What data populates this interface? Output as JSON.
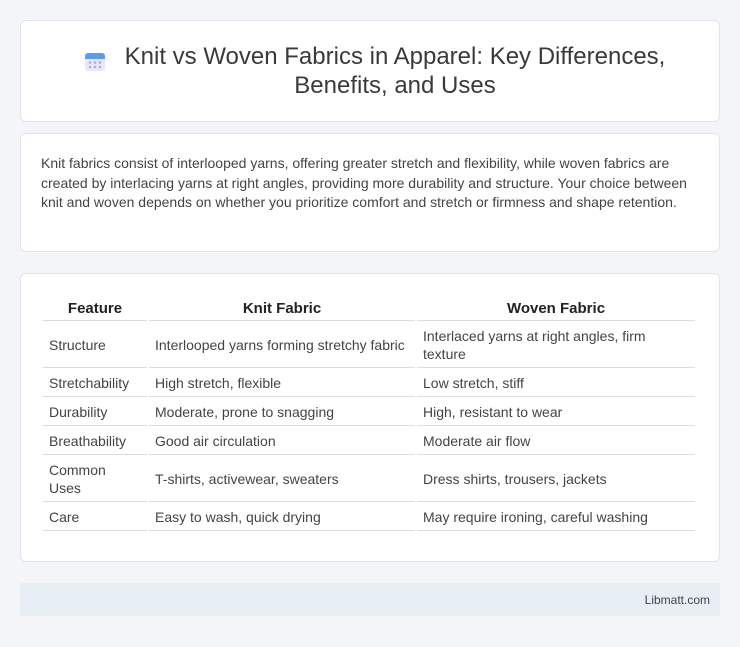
{
  "header": {
    "title": "Knit vs Woven Fabrics in Apparel: Key Differences, Benefits, and Uses",
    "icon": "calendar-icon",
    "icon_colors": {
      "top": "#5b9bf0",
      "body": "#e9e3f7",
      "dots": "#b9a3e8"
    }
  },
  "intro": {
    "text": "Knit fabrics consist of interlooped yarns, offering greater stretch and flexibility, while woven fabrics are created by interlacing yarns at right angles, providing more durability and structure. Your choice between knit and woven depends on whether you prioritize comfort and stretch or firmness and shape retention."
  },
  "table": {
    "headers": [
      "Feature",
      "Knit Fabric",
      "Woven Fabric"
    ],
    "rows": [
      [
        "Structure",
        "Interlooped yarns forming stretchy fabric",
        "Interlaced yarns at right angles, firm texture"
      ],
      [
        "Stretchability",
        "High stretch, flexible",
        "Low stretch, stiff"
      ],
      [
        "Durability",
        "Moderate, prone to snagging",
        "High, resistant to wear"
      ],
      [
        "Breathability",
        "Good air circulation",
        "Moderate air flow"
      ],
      [
        "Common Uses",
        "T-shirts, activewear, sweaters",
        "Dress shirts, trousers, jackets"
      ],
      [
        "Care",
        "Easy to wash, quick drying",
        "May require ironing, careful washing"
      ]
    ]
  },
  "footer": {
    "text": "Libmatt.com"
  }
}
